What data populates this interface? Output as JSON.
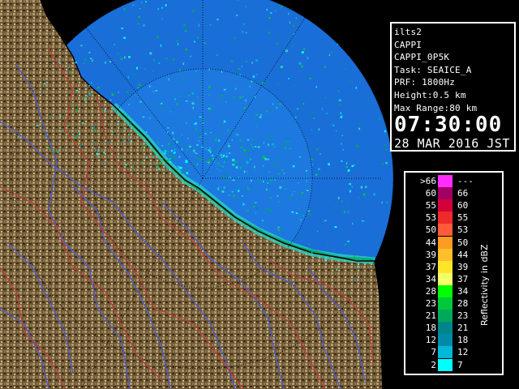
{
  "info": {
    "site": "ilts2",
    "product": "CAPPI",
    "product_name": "CAPPI_0P5K",
    "task": "Task: SEAICE_A",
    "prf": "PRF: 1800Hz",
    "height": "Height:0.5 km",
    "max_range": "Max Range:80 km",
    "time": "07:30:00",
    "date": "28 MAR 2016 JST"
  },
  "legend": {
    "title": "Reflectivity in dBZ",
    "rows": [
      {
        "lo": ">66",
        "hi": "---",
        "color": "#ff2eff"
      },
      {
        "lo": "60",
        "hi": "66",
        "color": "#a30063"
      },
      {
        "lo": "55",
        "hi": "60",
        "color": "#d3003a"
      },
      {
        "lo": "53",
        "hi": "55",
        "color": "#ee2a2a"
      },
      {
        "lo": "50",
        "hi": "53",
        "color": "#ff5a3a"
      },
      {
        "lo": "44",
        "hi": "50",
        "color": "#ff9a22"
      },
      {
        "lo": "39",
        "hi": "44",
        "color": "#ffbf2a"
      },
      {
        "lo": "37",
        "hi": "39",
        "color": "#ffe52a"
      },
      {
        "lo": "34",
        "hi": "37",
        "color": "#f5ff6a"
      },
      {
        "lo": "28",
        "hi": "34",
        "color": "#00ff00"
      },
      {
        "lo": "23",
        "hi": "28",
        "color": "#00c83a"
      },
      {
        "lo": "21",
        "hi": "23",
        "color": "#00a85a"
      },
      {
        "lo": "18",
        "hi": "21",
        "color": "#00868a"
      },
      {
        "lo": "12",
        "hi": "18",
        "color": "#008aa8"
      },
      {
        "lo": "7",
        "hi": "12",
        "color": "#00b8d8"
      },
      {
        "lo": "2",
        "hi": "7",
        "color": "#00ffff"
      }
    ]
  },
  "map": {
    "colors": {
      "background": "#000000",
      "radar_disc": "#1a6ed8",
      "land_dark": "#5a4628",
      "land_light": "#b09a6e",
      "rivers": "#4a5ad0",
      "boundaries": "#c23a3a",
      "range_rings": "#000000"
    }
  }
}
